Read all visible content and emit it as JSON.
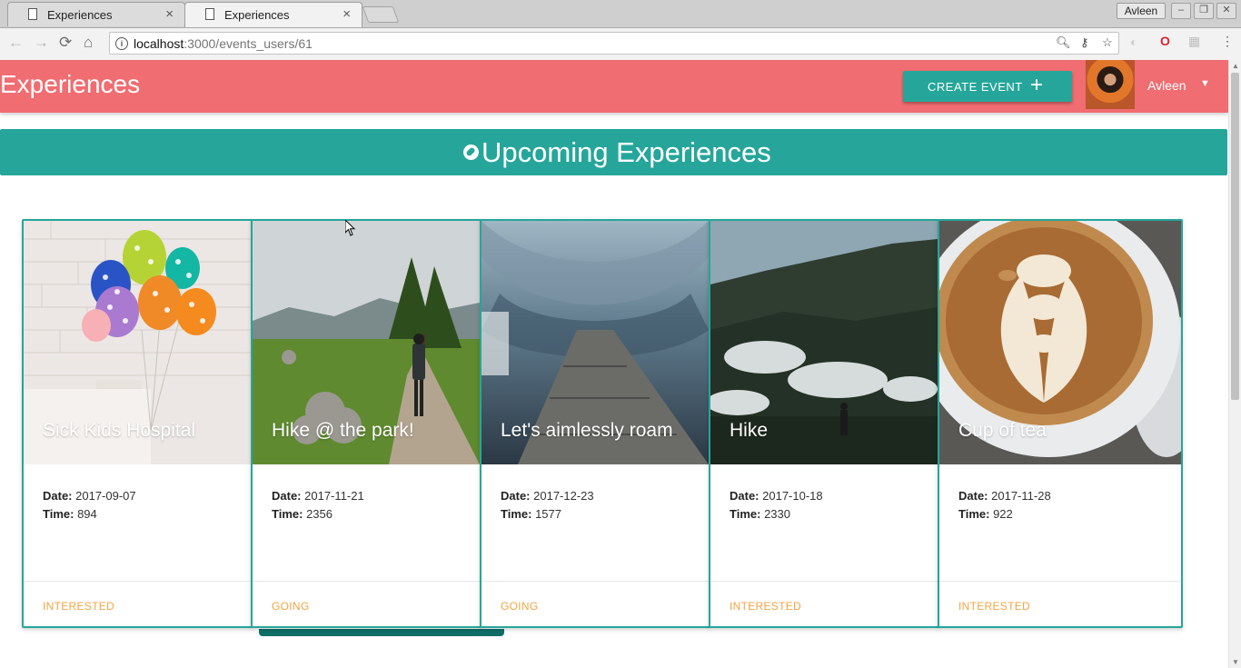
{
  "browser": {
    "tabs": [
      {
        "title": "Experiences",
        "active": false
      },
      {
        "title": "Experiences",
        "active": true
      }
    ],
    "tab_close_glyph": "×",
    "profile_name": "Avleen",
    "url_host": "localhost",
    "url_path": ":3000/events_users/61",
    "nav_icons": [
      "back-icon",
      "forward-icon",
      "reload-icon",
      "home-icon"
    ],
    "omnibox_icons": [
      "zoom-icon",
      "key-icon",
      "star-icon"
    ],
    "extension_icons": [
      "extension-icon",
      "opera-icon",
      "cast-icon",
      "menu-icon"
    ]
  },
  "app": {
    "title": "Experiences",
    "create_button": {
      "label": "CREATE EVENT",
      "icon": "plus-icon",
      "glyph": "+"
    },
    "user": {
      "name": "Avleen",
      "caret": "▼"
    },
    "banner_title": "Upcoming Experiences",
    "date_label": "Date:",
    "time_label": "Time:",
    "events": [
      {
        "title": "Sick Kids Hospital",
        "date": "2017-09-07",
        "time": "894",
        "status": "INTERESTED",
        "image": "balloons-photo"
      },
      {
        "title": "Hike @ the park!",
        "date": "2017-11-21",
        "time": "2356",
        "status": "GOING",
        "image": "hiker-trail-photo"
      },
      {
        "title": "Let's aimlessly roam",
        "date": "2017-12-23",
        "time": "1577",
        "status": "GOING",
        "image": "tunnel-boardwalk-photo"
      },
      {
        "title": "Hike",
        "date": "2017-10-18",
        "time": "2330",
        "status": "INTERESTED",
        "image": "misty-mountain-photo"
      },
      {
        "title": "Cup of tea",
        "date": "2017-11-28",
        "time": "922",
        "status": "INTERESTED",
        "image": "latte-art-photo"
      }
    ]
  },
  "colors": {
    "header": "#f06d72",
    "accent": "#26a69a",
    "status": "#f4a443"
  }
}
